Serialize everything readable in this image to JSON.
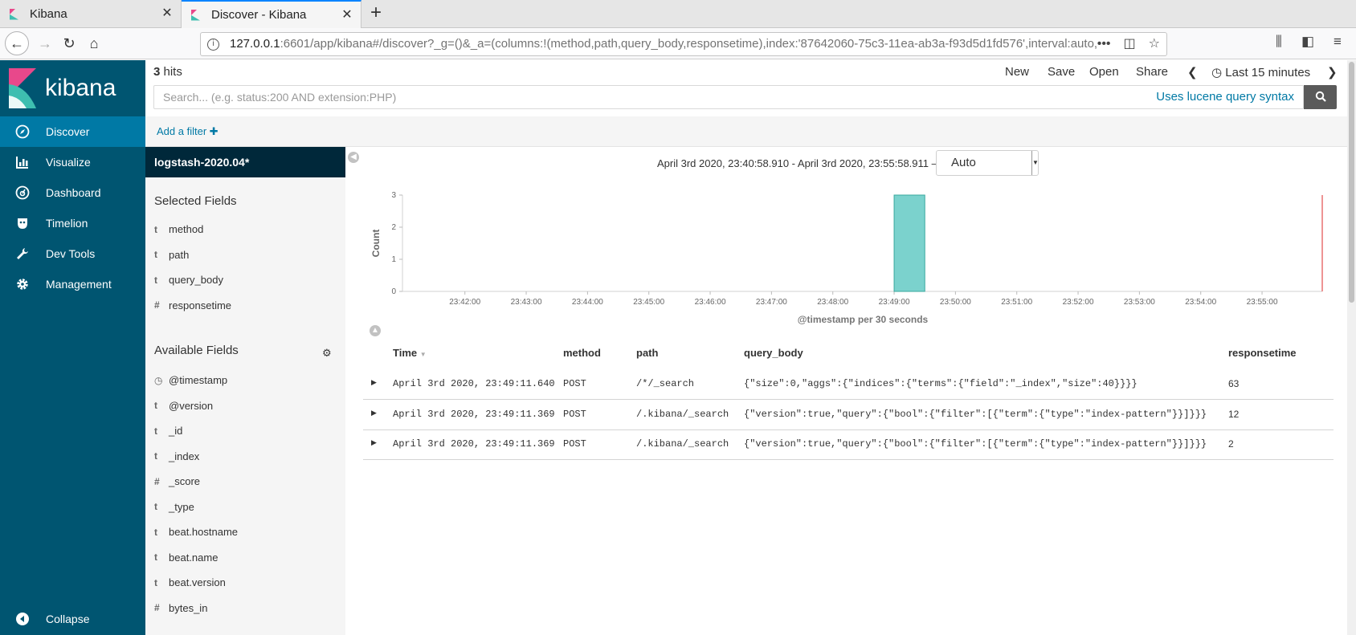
{
  "browser": {
    "tabs": [
      {
        "title": "Kibana"
      },
      {
        "title": "Discover - Kibana"
      }
    ],
    "url_host": "127.0.0.1",
    "url_rest": ":6601/app/kibana#/discover?_g=()&_a=(columns:!(method,path,query_body,responsetime),index:'87642060-75c3-11ea-ab3a-f93d5d1fd576',interval:auto,qu"
  },
  "sidebar": {
    "logo": "kibana",
    "items": [
      {
        "label": "Discover",
        "icon": "compass-icon"
      },
      {
        "label": "Visualize",
        "icon": "bar-chart-icon"
      },
      {
        "label": "Dashboard",
        "icon": "dashboard-icon"
      },
      {
        "label": "Timelion",
        "icon": "timelion-icon"
      },
      {
        "label": "Dev Tools",
        "icon": "wrench-icon"
      },
      {
        "label": "Management",
        "icon": "gear-icon"
      }
    ],
    "collapse": "Collapse"
  },
  "topbar": {
    "hits_count": "3",
    "hits_label": " hits",
    "menu": [
      "New",
      "Save",
      "Open",
      "Share"
    ],
    "time_label": "Last 15 minutes",
    "search_placeholder": "Search... (e.g. status:200 AND extension:PHP)",
    "lucene": "Uses lucene query syntax",
    "add_filter": "Add a filter"
  },
  "fields": {
    "index_pattern": "logstash-2020.04*",
    "selected_title": "Selected Fields",
    "selected": [
      {
        "type": "t",
        "name": "method"
      },
      {
        "type": "t",
        "name": "path"
      },
      {
        "type": "t",
        "name": "query_body"
      },
      {
        "type": "#",
        "name": "responsetime"
      }
    ],
    "available_title": "Available Fields",
    "available": [
      {
        "type": "clock",
        "name": "@timestamp"
      },
      {
        "type": "t",
        "name": "@version"
      },
      {
        "type": "t",
        "name": "_id"
      },
      {
        "type": "t",
        "name": "_index"
      },
      {
        "type": "#",
        "name": "_score"
      },
      {
        "type": "t",
        "name": "_type"
      },
      {
        "type": "t",
        "name": "beat.hostname"
      },
      {
        "type": "t",
        "name": "beat.name"
      },
      {
        "type": "t",
        "name": "beat.version"
      },
      {
        "type": "#",
        "name": "bytes_in"
      }
    ]
  },
  "histogram": {
    "range_text": "April 3rd 2020, 23:40:58.910 - April 3rd 2020, 23:55:58.911 —",
    "interval": "Auto"
  },
  "chart_data": {
    "type": "bar",
    "ylabel": "Count",
    "xlabel": "@timestamp per 30 seconds",
    "ylim": [
      0,
      3
    ],
    "yticks": [
      "0",
      "1",
      "2",
      "3"
    ],
    "xticks": [
      "23:42:00",
      "23:43:00",
      "23:44:00",
      "23:45:00",
      "23:46:00",
      "23:47:00",
      "23:48:00",
      "23:49:00",
      "23:50:00",
      "23:51:00",
      "23:52:00",
      "23:53:00",
      "23:54:00",
      "23:55:00"
    ],
    "bars": [
      {
        "x": "23:49:00",
        "count": 3
      }
    ],
    "bar_color": "#7bd2cd",
    "now_line_color": "#e87070"
  },
  "table": {
    "headers": [
      "Time",
      "method",
      "path",
      "query_body",
      "responsetime"
    ],
    "rows": [
      [
        "April 3rd 2020, 23:49:11.640",
        "POST",
        "/*/_search",
        "{\"size\":0,\"aggs\":{\"indices\":{\"terms\":{\"field\":\"_index\",\"size\":40}}}}",
        "63"
      ],
      [
        "April 3rd 2020, 23:49:11.369",
        "POST",
        "/.kibana/_search",
        "{\"version\":true,\"query\":{\"bool\":{\"filter\":[{\"term\":{\"type\":\"index-pattern\"}}]}}}",
        "12"
      ],
      [
        "April 3rd 2020, 23:49:11.369",
        "POST",
        "/.kibana/_search",
        "{\"version\":true,\"query\":{\"bool\":{\"filter\":[{\"term\":{\"type\":\"index-pattern\"}}]}}}",
        "2"
      ]
    ]
  },
  "colors": {
    "sidebar": "#005571",
    "active": "#0079a5",
    "index_bar": "#00283a",
    "link": "#0079a5"
  }
}
